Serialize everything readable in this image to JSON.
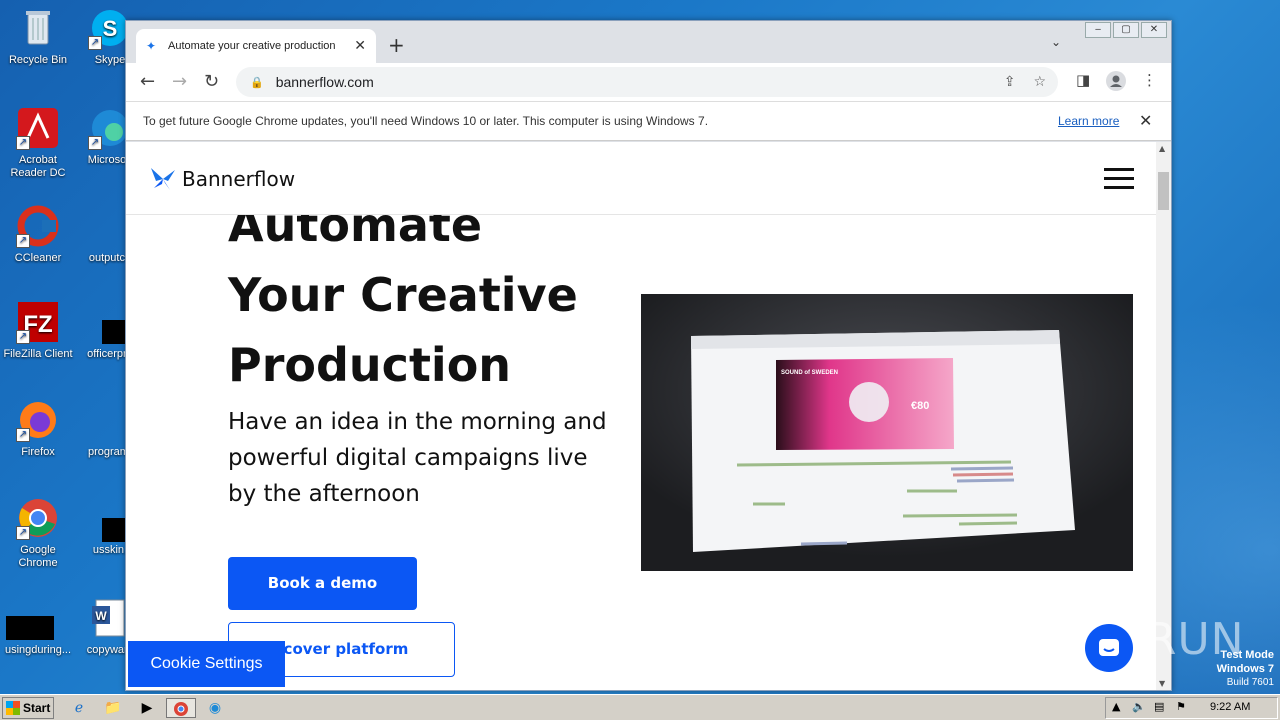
{
  "desktop": {
    "icons": [
      {
        "label": "Recycle Bin"
      },
      {
        "label": "Skype"
      },
      {
        "label": "Acrobat Reader DC"
      },
      {
        "label": "Microsoft"
      },
      {
        "label": "CCleaner"
      },
      {
        "label": "outputcd"
      },
      {
        "label": "FileZilla Client"
      },
      {
        "label": "officerpro"
      },
      {
        "label": "Firefox"
      },
      {
        "label": "programf"
      },
      {
        "label": "Google Chrome"
      },
      {
        "label": "usskin."
      },
      {
        "label": "usingduring..."
      },
      {
        "label": "copywant"
      }
    ]
  },
  "browser": {
    "tab_title": "Automate your creative production",
    "url": "bannerflow.com",
    "infobar_text": "To get future Google Chrome updates, you'll need Windows 10 or later. This computer is using Windows 7.",
    "infobar_link": "Learn more"
  },
  "page": {
    "brand": "Bannerflow",
    "headline_1": "Automate",
    "headline_2": "Your Creative",
    "headline_3": "Production",
    "subtext": "Have an idea in the morning and powerful digital campaigns live by the afternoon",
    "cta_primary": "Book a demo",
    "cta_secondary": "scover platform",
    "cookie_settings": "Cookie Settings",
    "media": {
      "banner_brand": "SOUND of SWEDEN",
      "banner_price": "€80"
    }
  },
  "watermark": {
    "text": "ANY RUN",
    "mode": "Test Mode",
    "os": "Windows 7",
    "build": "Build 7601"
  },
  "taskbar": {
    "start_label": "Start",
    "clock": "9:22 AM"
  },
  "colors": {
    "accent": "#0b57f4",
    "desktop": "#1c6fb8"
  }
}
